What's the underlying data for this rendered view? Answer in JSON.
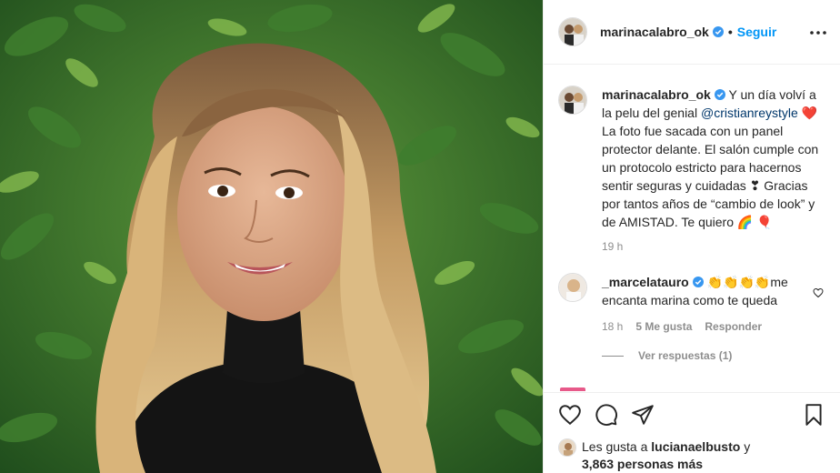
{
  "post": {
    "author": "marinacalabro_ok",
    "follow_label": "Seguir",
    "separator": "•",
    "caption": {
      "part1": "Y un día volví a la pelu del genial",
      "mention": "@cristianreystyle",
      "emoji_heart": "❤️",
      "part2": "La foto fue sacada con un panel protector delante. El salón cumple con un protocolo estricto para hacernos sentir seguras y cuidadas",
      "emoji_heart2": "❣",
      "part3": "Gracias por tantos años de “cambio de look” y de AMISTAD. Te quiero",
      "emoji_rainbow": "🌈",
      "emoji_balloon": "🎈"
    },
    "time": "19 h"
  },
  "comments": [
    {
      "user": "_marcelatauro",
      "emoji": "👏👏👏👏",
      "text": "me encanta marina como te queda",
      "time": "18 h",
      "likes": "5 Me gusta",
      "reply_label": "Responder",
      "view_replies": "Ver respuestas (1)"
    }
  ],
  "likes": {
    "prefix": "Les gusta a",
    "user": "lucianaelbusto",
    "conj": "y",
    "others": "3,863 personas más"
  },
  "colors": {
    "accent": "#0095f6",
    "verified": "#3897f0",
    "text": "#262626",
    "muted": "#8e8e8e",
    "heart": "#ed4956"
  },
  "icons": [
    "verified-icon",
    "more-options-icon",
    "like-icon",
    "comment-icon",
    "share-icon",
    "save-icon"
  ]
}
